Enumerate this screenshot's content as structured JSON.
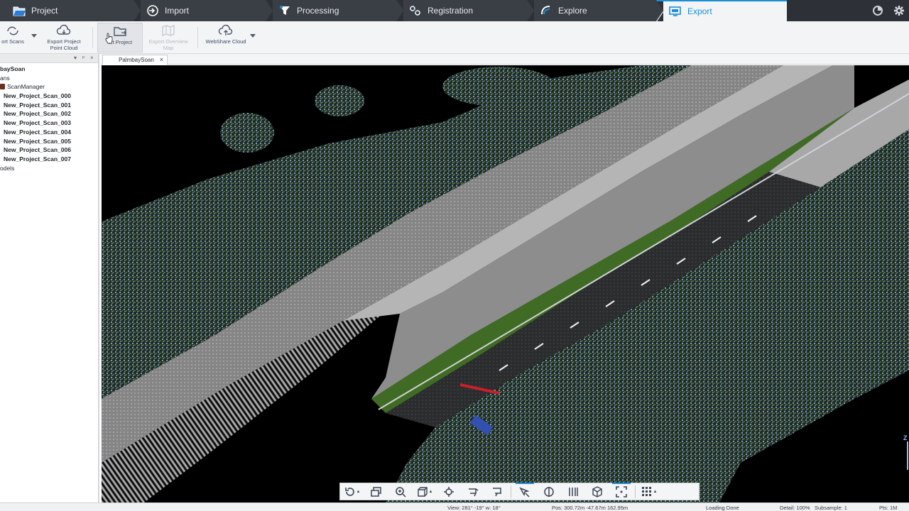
{
  "workflow_tabs": [
    {
      "label": "Project",
      "icon": "folder-icon"
    },
    {
      "label": "Import",
      "icon": "import-icon"
    },
    {
      "label": "Processing",
      "icon": "funnel-icon"
    },
    {
      "label": "Registration",
      "icon": "registration-icon"
    },
    {
      "label": "Explore",
      "icon": "explore-icon"
    },
    {
      "label": "Export",
      "icon": "monitor-export-icon"
    }
  ],
  "active_tab": "Export",
  "accent_color": "#1b8fd6",
  "ribbon": {
    "export_scans": "ort Scans",
    "export_point_cloud_line1": "Export Project",
    "export_point_cloud_line2": "Point Cloud",
    "export_project": "ort Project",
    "export_overview_line1": "Export Overview",
    "export_overview_line2": "Map",
    "webshare": "WebShare Cloud"
  },
  "tree": {
    "project": "baySoan",
    "scans": "ans",
    "scan_manager": "ScanManager",
    "scans_list": [
      "New_Project_Scan_000",
      "New_Project_Scan_001",
      "New_Project_Scan_002",
      "New_Project_Scan_003",
      "New_Project_Scan_004",
      "New_Project_Scan_005",
      "New_Project_Scan_006",
      "New_Project_Scan_007"
    ],
    "models": "odels"
  },
  "doc_tab": {
    "label": "PalmbaySoan",
    "close": "×"
  },
  "axis_label": "Z",
  "status": {
    "view": "View: 281° -19° w: 18°",
    "pos": "Pos: 300.72m -47.67m 162.95m",
    "loading": "Loading Done",
    "detail": "Detail: 100%",
    "subsample": "Subsample:  1",
    "pts": "Pts:  1M"
  }
}
